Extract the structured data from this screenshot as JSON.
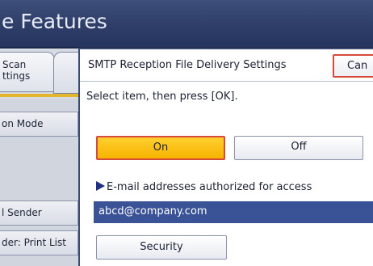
{
  "header": {
    "title": "e Features"
  },
  "background": {
    "tab_label_line1": "Scan",
    "tab_label_line2": "ttings",
    "list_items": [
      "on Mode",
      "l Sender",
      "der: Print List"
    ]
  },
  "dialog": {
    "title": "SMTP Reception File Delivery Settings",
    "cancel_label": "Can",
    "instruction": "Select item, then press [OK].",
    "options": [
      {
        "label": "On",
        "selected": true
      },
      {
        "label": "Off",
        "selected": false
      }
    ],
    "section_label": "E-mail addresses authorized for access",
    "email_value": "abcd@company.com",
    "security_label": "Security"
  },
  "colors": {
    "title_bar": "#2e3e68",
    "selected_option": "#f6b300",
    "highlight_border": "#d64a3a",
    "email_row": "#3a5296",
    "triangle": "#1f2f86"
  }
}
